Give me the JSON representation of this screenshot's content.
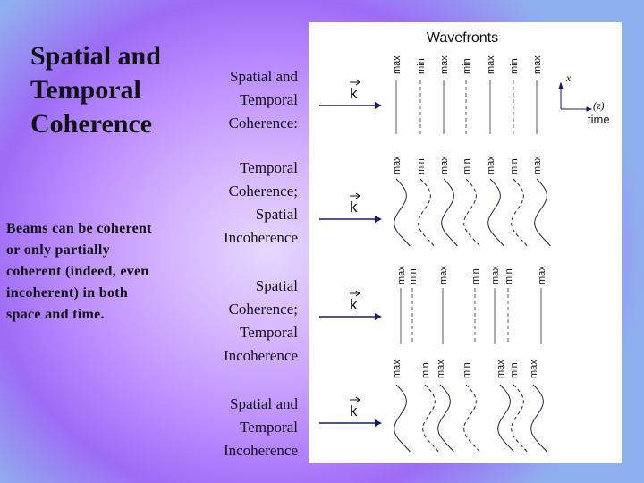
{
  "slide": {
    "title_lines": [
      "Spatial and",
      "Temporal",
      "Coherence"
    ],
    "body": "Beams can be coherent or only partially coherent (indeed, even incoherent) in both space and time.",
    "colors": {
      "wave_line": "#222244",
      "arrow": "#1a1a6a",
      "text": "#111111"
    }
  },
  "rows": [
    {
      "label_lines": [
        "Spatial and",
        "Temporal",
        "Coherence:"
      ]
    },
    {
      "label_lines": [
        "Temporal",
        "Coherence;",
        "Spatial",
        "Incoherence"
      ]
    },
    {
      "label_lines": [
        "Spatial",
        "Coherence;",
        "Temporal",
        "Incoherence"
      ]
    },
    {
      "label_lines": [
        "Spatial and",
        "Temporal",
        "Incoherence"
      ]
    }
  ],
  "diagram": {
    "title": "Wavefronts",
    "k_label": "k",
    "axis": {
      "vertical": "x",
      "horizontal": "(z)",
      "sub": "time"
    },
    "panels": [
      {
        "wavy": false,
        "fronts": [
          "max",
          "min",
          "max",
          "min",
          "max",
          "min",
          "max"
        ]
      },
      {
        "wavy": true,
        "fronts": [
          "max",
          "min",
          "max",
          "min",
          "max",
          "min",
          "max"
        ]
      },
      {
        "wavy": false,
        "fronts": [
          "max",
          "min",
          "max",
          "min",
          "max",
          "min",
          "max"
        ]
      },
      {
        "wavy": true,
        "fronts": [
          "max",
          "min",
          "max",
          "min",
          "max",
          "min",
          "max"
        ]
      }
    ]
  }
}
